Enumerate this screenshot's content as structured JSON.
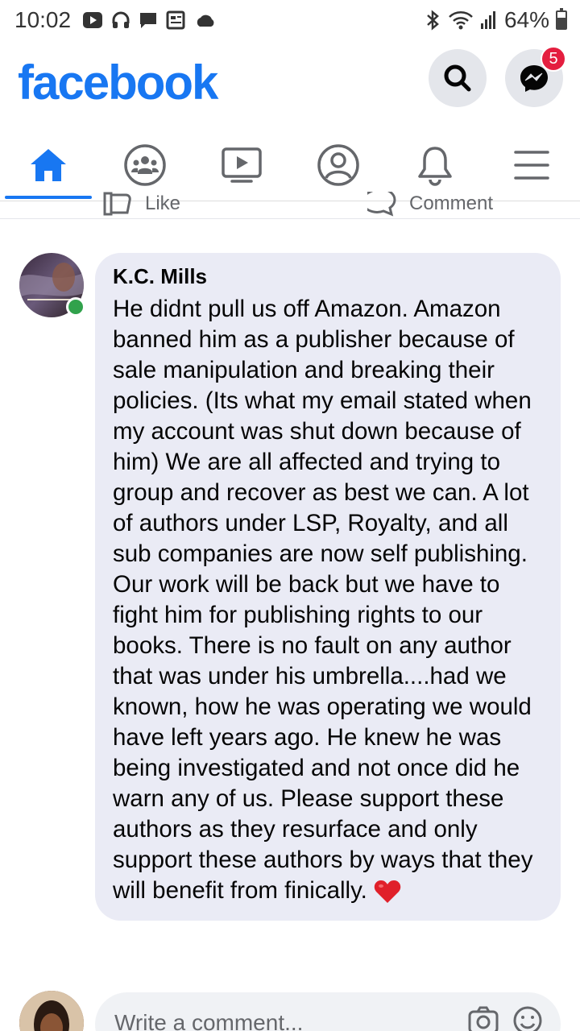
{
  "status_bar": {
    "time": "10:02",
    "battery": "64%",
    "battery_level": 0.64,
    "icons": [
      "cast-icon",
      "headphones-icon",
      "chat-icon",
      "news-icon",
      "cloud-icon",
      "bluetooth-icon",
      "wifi-icon",
      "signal-icon",
      "battery-icon"
    ]
  },
  "header": {
    "logo": "facebook",
    "messenger_badge": "5"
  },
  "nav": {
    "tabs": [
      {
        "name": "home",
        "active": true
      },
      {
        "name": "groups",
        "active": false
      },
      {
        "name": "watch",
        "active": false
      },
      {
        "name": "profile",
        "active": false
      },
      {
        "name": "notifications",
        "active": false
      },
      {
        "name": "menu",
        "active": false
      }
    ]
  },
  "post_actions": {
    "like_label": "Like",
    "comment_label": "Comment"
  },
  "comment": {
    "author": "K.C. Mills",
    "text": "He didnt pull us off Amazon. Amazon banned him as a publisher because of sale manipulation and breaking their policies. (Its what my email stated when my account was shut down because of him) We are all affected and trying to group and recover as best we can. A lot of authors under LSP, Royalty, and all sub companies are now self publishing. Our work will be back but we have to fight him for publishing rights to our books. There is no fault on any author that was under his umbrella....had we known, how he was operating we would have left years ago. He knew he was being investigated and not once did he warn any of us. Please support these authors as they resurface and only support these authors by ways that they will benefit from finically."
  },
  "compose": {
    "placeholder": "Write a comment..."
  },
  "colors": {
    "brand": "#1877f2",
    "badge": "#e41e3f",
    "online": "#31a24c",
    "bubble": "#eaebf5"
  }
}
